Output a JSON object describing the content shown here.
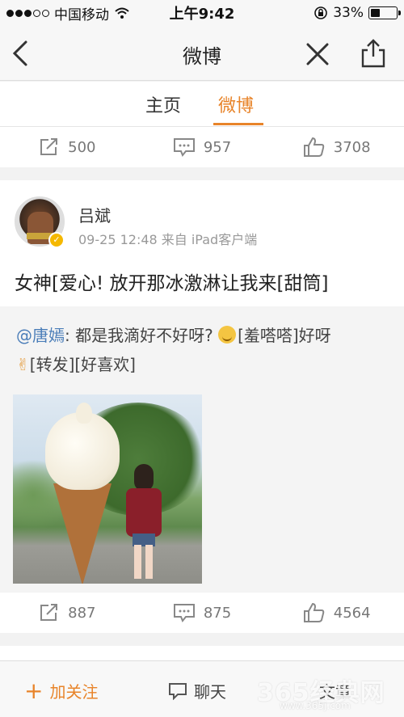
{
  "status_bar": {
    "carrier": "中国移动",
    "time": "上午9:42",
    "battery": "33%",
    "battery_level": 0.33
  },
  "nav": {
    "title": "微博",
    "back_icon": "chevron-left-icon",
    "close_icon": "close-icon",
    "share_icon": "share-icon"
  },
  "tabs": [
    {
      "label": "主页",
      "active": false
    },
    {
      "label": "微博",
      "active": true
    }
  ],
  "previous_post_stats": {
    "reposts": "500",
    "comments": "957",
    "likes": "3708"
  },
  "post": {
    "user_name": "吕斌",
    "meta": "09-25 12:48 来自 iPad客户端",
    "verified": true,
    "text": "女神[爱心!   放开那冰激淋让我来[甜筒]",
    "repost": {
      "mention": "@唐嫣",
      "text_part1": ": 都是我滴好不好呀? ",
      "text_part2": "[羞嗒嗒]好呀",
      "text_part3": "[转发][好喜欢]"
    },
    "stats": {
      "reposts": "887",
      "comments": "875",
      "likes": "4564"
    }
  },
  "bottom_bar": {
    "follow": "加关注",
    "chat": "聊天",
    "article": "文章"
  },
  "watermark": {
    "main": "365经典网",
    "sub": "www.365j.com"
  },
  "colors": {
    "accent": "#e8842a",
    "link": "#4a7db8"
  }
}
